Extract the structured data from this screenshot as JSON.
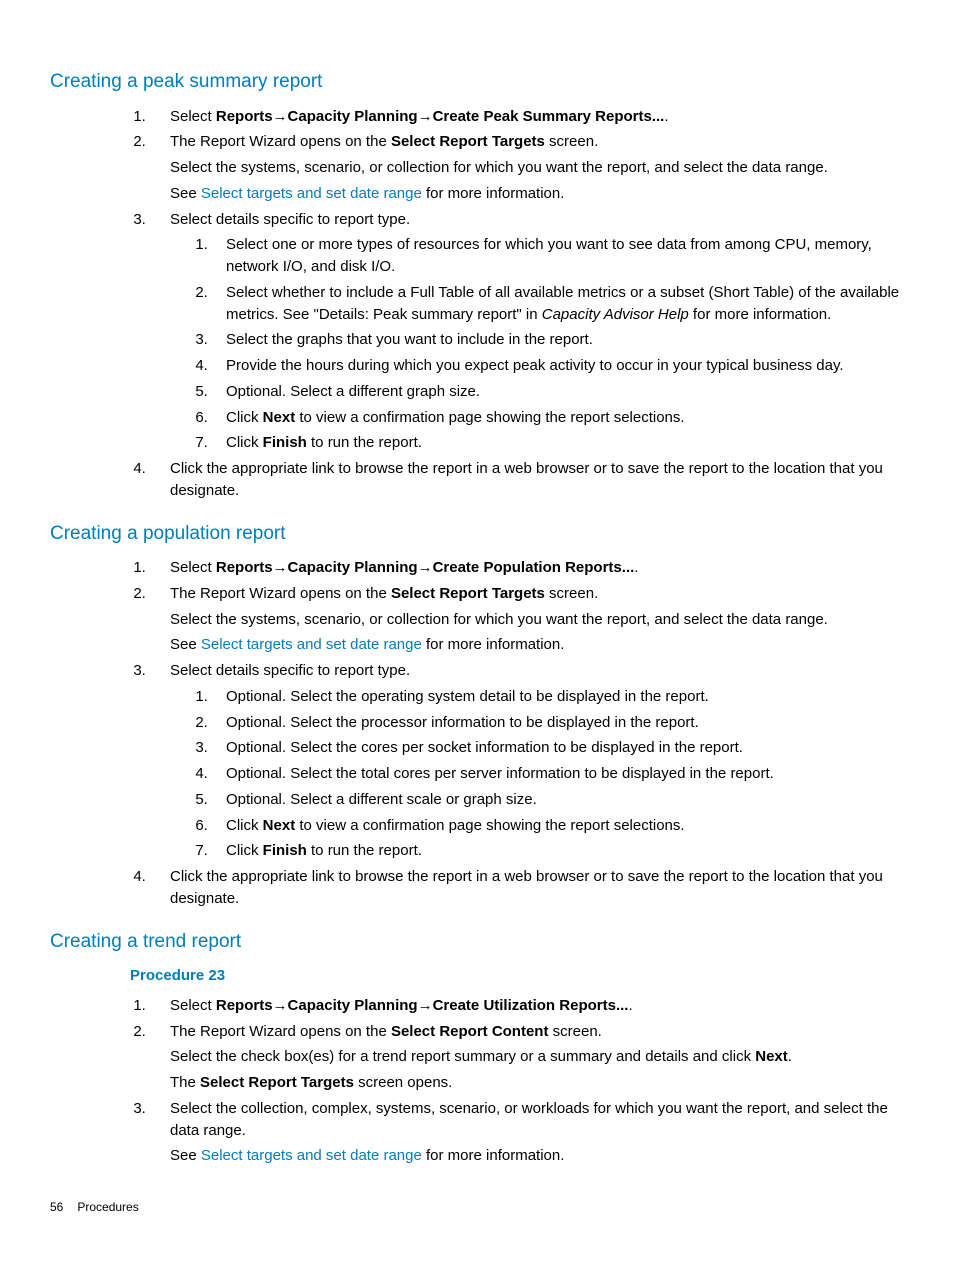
{
  "common": {
    "arrow": "→",
    "seePrefix": "See ",
    "seeLink": "Select targets and set date range",
    "seeSuffix": " for more information.",
    "nextWord": "Next",
    "finishWord": "Finish"
  },
  "peak": {
    "heading": "Creating a peak summary report",
    "step1_prefix": "Select ",
    "step1_path1": "Reports",
    "step1_path2": "Capacity Planning",
    "step1_path3": "Create Peak Summary Reports...",
    "step1_suffix": ".",
    "step2_line1a": "The Report Wizard opens on the ",
    "step2_line1b": "Select Report Targets",
    "step2_line1c": " screen.",
    "step2_line2": "Select the systems, scenario, or collection for which you want the report, and select the data range.",
    "step3_line": "Select details specific to report type.",
    "step3_sub": [
      "Select one or more types of resources for which you want to see data from among CPU, memory, network I/O, and disk I/O.",
      {
        "pre": "Select whether to include a Full Table of all available metrics or a subset (Short Table) of the available metrics. See \"Details: Peak summary report\" in ",
        "italic": "Capacity Advisor Help",
        "post": " for more information."
      },
      "Select the graphs that you want to include in the report.",
      "Provide the hours during which you expect peak activity to occur in your typical business day.",
      "Optional. Select a different graph size.",
      {
        "pre": "Click ",
        "bold": "Next",
        "post": " to view a confirmation page showing the report selections."
      },
      {
        "pre": "Click ",
        "bold": "Finish",
        "post": " to run the report."
      }
    ],
    "step4": "Click the appropriate link to browse the report in a web browser or to save the report to the location that you designate."
  },
  "population": {
    "heading": "Creating a population report",
    "step1_path3": "Create Population Reports...",
    "step2_line1a": "The Report Wizard opens on the ",
    "step2_line1b": "Select Report Targets",
    "step2_line1c": " screen.",
    "step2_line2": "Select the systems, scenario, or collection for which you want the report, and select the data range.",
    "step3_line": "Select details specific to report type.",
    "step3_sub": [
      "Optional. Select the operating system detail to be displayed in the report.",
      "Optional. Select the processor information to be displayed in the report.",
      "Optional. Select the cores per socket information to be displayed in the report.",
      "Optional. Select the total cores per server information to be displayed in the report.",
      "Optional. Select a different scale or graph size.",
      {
        "pre": "Click ",
        "bold": "Next",
        "post": " to view a confirmation page showing the report selections."
      },
      {
        "pre": "Click ",
        "bold": "Finish",
        "post": " to run the report."
      }
    ],
    "step4": "Click the appropriate link to browse the report in a web browser or to save the report to the location that you designate."
  },
  "trend": {
    "heading": "Creating a trend report",
    "procedure": "Procedure 23",
    "step1_path3": "Create Utilization Reports...",
    "step2_line1a": "The Report Wizard opens on the ",
    "step2_line1b": "Select Report Content",
    "step2_line1c": " screen.",
    "step2_line2_pre": "Select the check box(es) for a trend report summary or a summary and details and click ",
    "step2_line2_bold": "Next",
    "step2_line2_post": ".",
    "step2_line3a": "The ",
    "step2_line3b": "Select Report Targets",
    "step2_line3c": " screen opens.",
    "step3": "Select the collection, complex, systems, scenario, or workloads for which you want the report, and select the data range."
  },
  "footer": {
    "page": "56",
    "section": "Procedures"
  }
}
